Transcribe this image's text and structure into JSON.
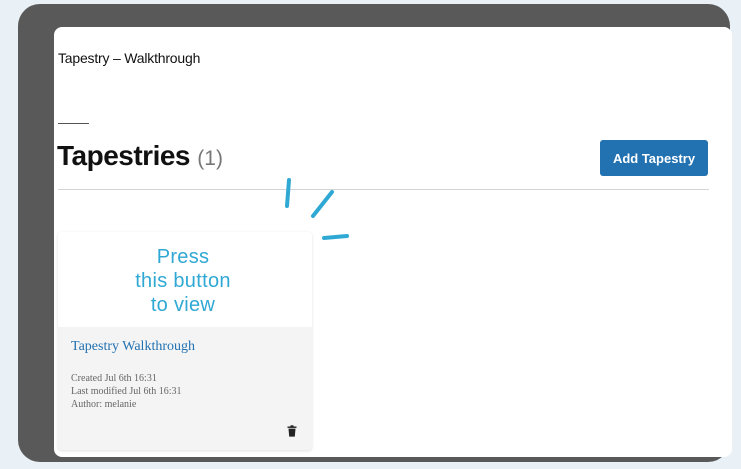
{
  "page": {
    "doc_title": "Tapestry – Walkthrough",
    "heading": "Tapestries",
    "count": "(1)",
    "add_button": "Add Tapestry"
  },
  "card": {
    "overlay_lines": [
      "Press",
      "this button",
      "to view"
    ],
    "title": "Tapestry Walkthrough",
    "created": "Created Jul 6th 16:31",
    "modified": "Last modified Jul 6th 16:31",
    "author": "Author: melanie",
    "delete_icon": "trash-icon"
  },
  "colors": {
    "accent": "#2271b1",
    "annotation": "#2fa9d4",
    "frame": "#595959",
    "background": "#e9f1f6"
  }
}
